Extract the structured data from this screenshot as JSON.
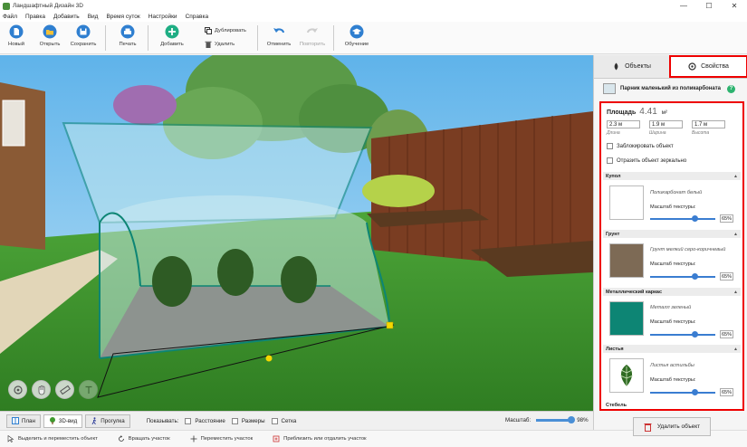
{
  "window": {
    "title": "Ландшафтный Дизайн 3D",
    "controls": [
      "—",
      "☐",
      "✕"
    ]
  },
  "menu": [
    "Файл",
    "Правка",
    "Добавить",
    "Вид",
    "Время суток",
    "Настройки",
    "Справка"
  ],
  "toolbar": {
    "new": "Новый",
    "open": "Открыть",
    "save": "Сохранить",
    "print": "Печать",
    "add": "Добавить",
    "duplicate": "Дублировать",
    "delete": "Удалить",
    "undo": "Отменить",
    "redo": "Повторить",
    "learning": "Обучение"
  },
  "viewbar": {
    "tabs": [
      "План",
      "3D-вид",
      "Прогулка"
    ],
    "active_tab": "3D-вид",
    "show_label": "Показывать:",
    "checks": [
      "Расстояние",
      "Размеры",
      "Сетка"
    ],
    "scale_label": "Масштаб:",
    "scale_value": "98%"
  },
  "statusbar": [
    "Выделить и переместить объект",
    "Вращать участок",
    "Переместить участок",
    "Приблизить или отдалить участок"
  ],
  "panel": {
    "tabs": [
      "Объекты",
      "Свойства"
    ],
    "active_tab": "Свойства",
    "object_name": "Парник маленький из поликарбоната",
    "help": "?",
    "area_label": "Площадь",
    "area_value": "4.41",
    "area_unit": "м²",
    "dims": [
      {
        "value": "2.3 м",
        "label": "Длина"
      },
      {
        "value": "1.9 м",
        "label": "Ширина"
      },
      {
        "value": "1.7 м",
        "label": "Высота"
      }
    ],
    "lock": "Заблокировать объект",
    "mirror": "Отразить объект зеркально",
    "sections": [
      {
        "title": "Купол",
        "material": "Поликарбонат белый",
        "scale_label": "Масштаб текстуры:",
        "scale": "65%",
        "swatch": "#ffffff"
      },
      {
        "title": "Грунт",
        "material": "Грунт мелкий серо-коричневый",
        "scale_label": "Масштаб текстуры:",
        "scale": "65%",
        "swatch": "#7d6a55"
      },
      {
        "title": "Металлический каркас",
        "material": "Металл зеленый",
        "scale_label": "Масштаб текстуры:",
        "scale": "65%",
        "swatch": "#0d8574"
      },
      {
        "title": "Листья",
        "material": "Листья астильбы",
        "scale_label": "Масштаб текстуры:",
        "scale": "65%",
        "swatch": "#ffffff"
      }
    ],
    "stem_label": "Стебель",
    "delete_button": "Удалить объект"
  },
  "colors": {
    "accent": "#2f7fd0",
    "highlight": "#e00000",
    "frame": "#0d8574",
    "grass": "#3f9a2e"
  }
}
